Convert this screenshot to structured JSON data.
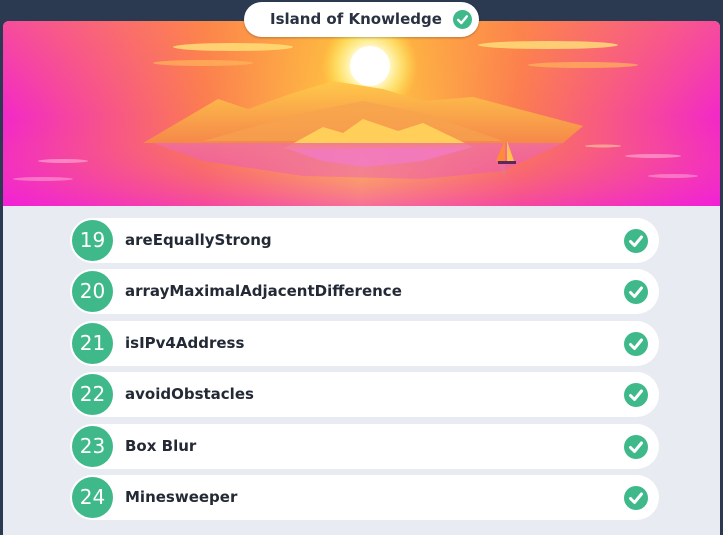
{
  "header": {
    "title": "Island of Knowledge",
    "completed_icon": "check-circle-icon"
  },
  "banner": {
    "image": "island-sunset-illustration"
  },
  "tasks": [
    {
      "number": "19",
      "name": "areEquallyStrong",
      "completed": true
    },
    {
      "number": "20",
      "name": "arrayMaximalAdjacentDifference",
      "completed": true
    },
    {
      "number": "21",
      "name": "isIPv4Address",
      "completed": true
    },
    {
      "number": "22",
      "name": "avoidObstacles",
      "completed": true
    },
    {
      "number": "23",
      "name": "Box Blur",
      "completed": true
    },
    {
      "number": "24",
      "name": "Minesweeper",
      "completed": true
    }
  ],
  "colors": {
    "accent_green": "#3fb88a",
    "page_bg": "#2b3a50",
    "list_bg": "#e8ebf1"
  }
}
